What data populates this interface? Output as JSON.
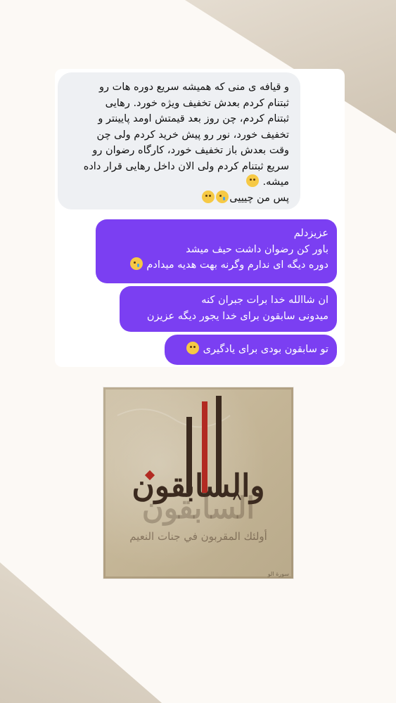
{
  "colors": {
    "page_background": "#fcf9f5",
    "incoming_bubble": "#eef0f3",
    "outgoing_bubble": "#7b3ff2",
    "outgoing_text": "#ffffff",
    "art_background": "#c4b596",
    "art_accent_red": "#b22a22",
    "art_text_dark": "#3b2a1f"
  },
  "chat": {
    "incoming": {
      "lines": [
        "و قیافه ی منی که همیشه سریع دوره هات رو",
        "ثبتنام کردم بعدش تخفیف ویژه خورد. رهایی",
        "ثبتنام کردم، چن روز بعد قیمتش اومد پایینتر و",
        "تخفیف خورد، نور رو پیش خرید کردم ولی چن",
        "وقت بعدش باز تخفیف خورد، کارگاه رضوان رو",
        "سریع ثبتنام کردم ولی الان داخل رهایی قرار داده",
        "میشه.",
        "پس من چیییی"
      ],
      "emojis": [
        "grimacing-face",
        "crying-face",
        "eye-roll-face"
      ]
    },
    "outgoing": [
      {
        "lines": [
          "عزیزدلم",
          "باور کن رضوان داشت حیف میشد",
          "دوره دیگه ای ندارم وگرنه بهت هدیه میدادم"
        ],
        "emoji": "crying-face"
      },
      {
        "lines": [
          "ان شاالله خدا برات جبران کنه",
          "میدونی سابقون برای خدا یجور دیگه عزیزن"
        ]
      },
      {
        "lines": [
          "تو سابقون بودی برای یادگیری"
        ],
        "emoji": "pleading-face"
      }
    ]
  },
  "artwork": {
    "title": "والسابقون",
    "title_echo": "السابقون",
    "subtitle": "أولئك المقربون في جنات النعيم",
    "caption": "سورة الو"
  }
}
